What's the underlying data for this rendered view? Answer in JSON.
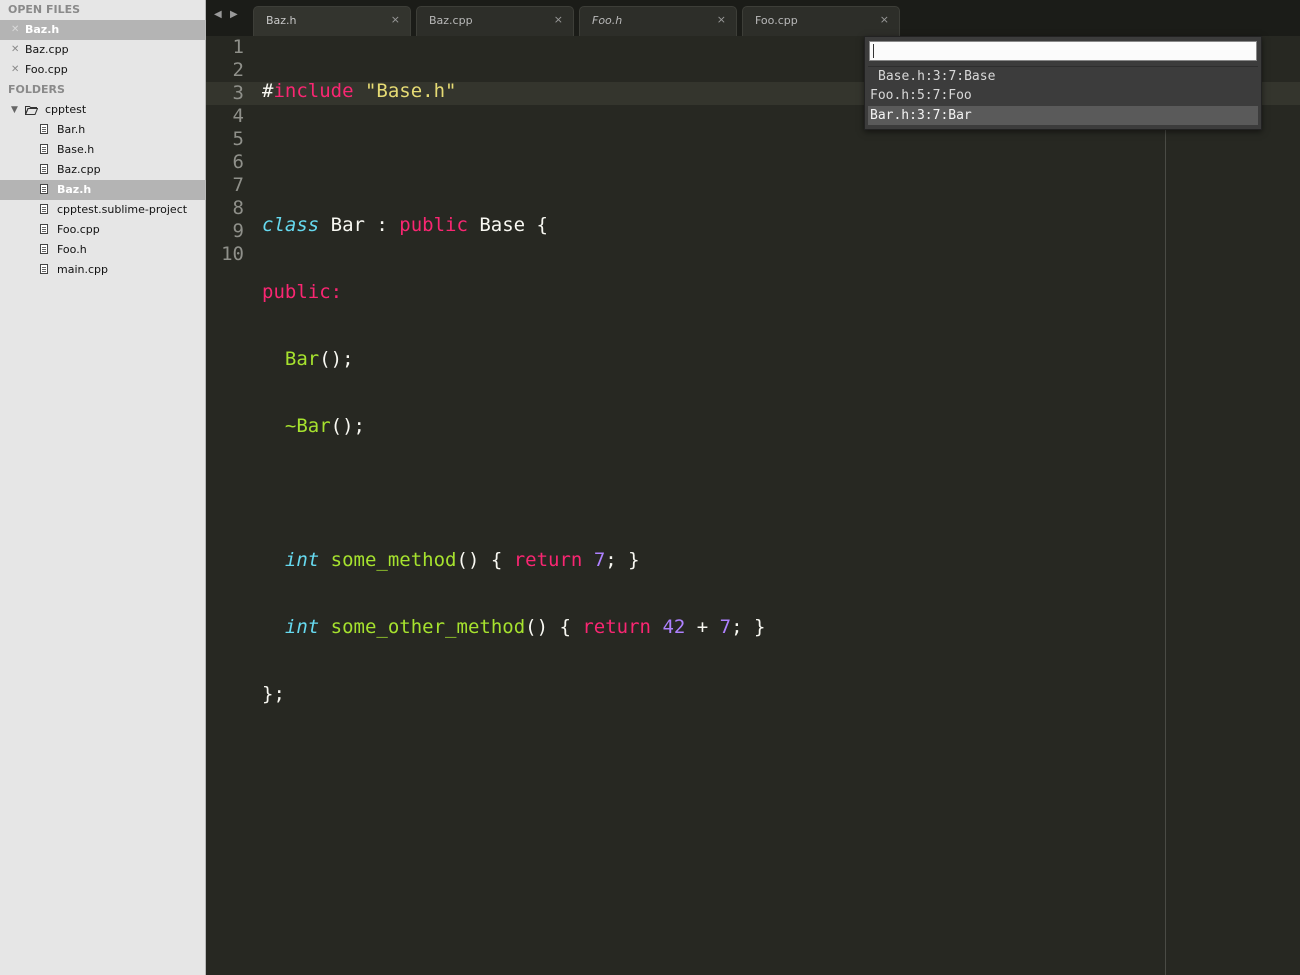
{
  "sidebar": {
    "open_files_header": "OPEN FILES",
    "open_files": [
      {
        "name": "Baz.h",
        "selected": true
      },
      {
        "name": "Baz.cpp",
        "selected": false
      },
      {
        "name": "Foo.cpp",
        "selected": false
      }
    ],
    "folders_header": "FOLDERS",
    "folder": {
      "name": "cpptest",
      "files": [
        "Bar.h",
        "Base.h",
        "Baz.cpp",
        "Baz.h",
        "cpptest.sublime-project",
        "Foo.cpp",
        "Foo.h",
        "main.cpp"
      ],
      "selected_file": "Baz.h"
    }
  },
  "tabs": [
    {
      "label": "Baz.h",
      "active": true,
      "italic": false
    },
    {
      "label": "Baz.cpp",
      "active": false,
      "italic": false
    },
    {
      "label": "Foo.h",
      "active": false,
      "italic": true
    },
    {
      "label": "Foo.cpp",
      "active": false,
      "italic": false
    }
  ],
  "tab_close_glyph": "×",
  "editor": {
    "current_line": 3,
    "line_numbers": [
      "1",
      "2",
      "3",
      "4",
      "5",
      "6",
      "7",
      "8",
      "9",
      "10"
    ],
    "code": {
      "l1": {
        "a": "#",
        "b": "include",
        "c": " ",
        "d": "\"Base.h\""
      },
      "l3": {
        "a": "class",
        "b": " Bar : ",
        "c": "public",
        "d": " Base {"
      },
      "l4": {
        "a": "public:"
      },
      "l5": {
        "a": "  ",
        "b": "Bar",
        "c": "();"
      },
      "l6": {
        "a": "  ",
        "b": "~Bar",
        "c": "();"
      },
      "l8": {
        "a": "  ",
        "b": "int",
        "c": " ",
        "d": "some_method",
        "e": "() { ",
        "f": "return",
        "g": " ",
        "h": "7",
        "i": "; }"
      },
      "l9": {
        "a": "  ",
        "b": "int",
        "c": " ",
        "d": "some_other_method",
        "e": "() { ",
        "f": "return",
        "g": " ",
        "h": "42",
        "i": " + ",
        "j": "7",
        "k": "; }"
      },
      "l10": {
        "a": "};"
      }
    }
  },
  "quick_panel": {
    "input_value": "",
    "items": [
      "Base.h:3:7:Base",
      "Foo.h:5:7:Foo",
      "Bar.h:3:7:Bar"
    ],
    "selected_index": 2
  },
  "colors": {
    "background": "#272822",
    "keyword_pink": "#f92672",
    "keyword_blue": "#66d9ef",
    "string": "#e6db74",
    "function": "#a6e22e",
    "number": "#ae81ff"
  }
}
